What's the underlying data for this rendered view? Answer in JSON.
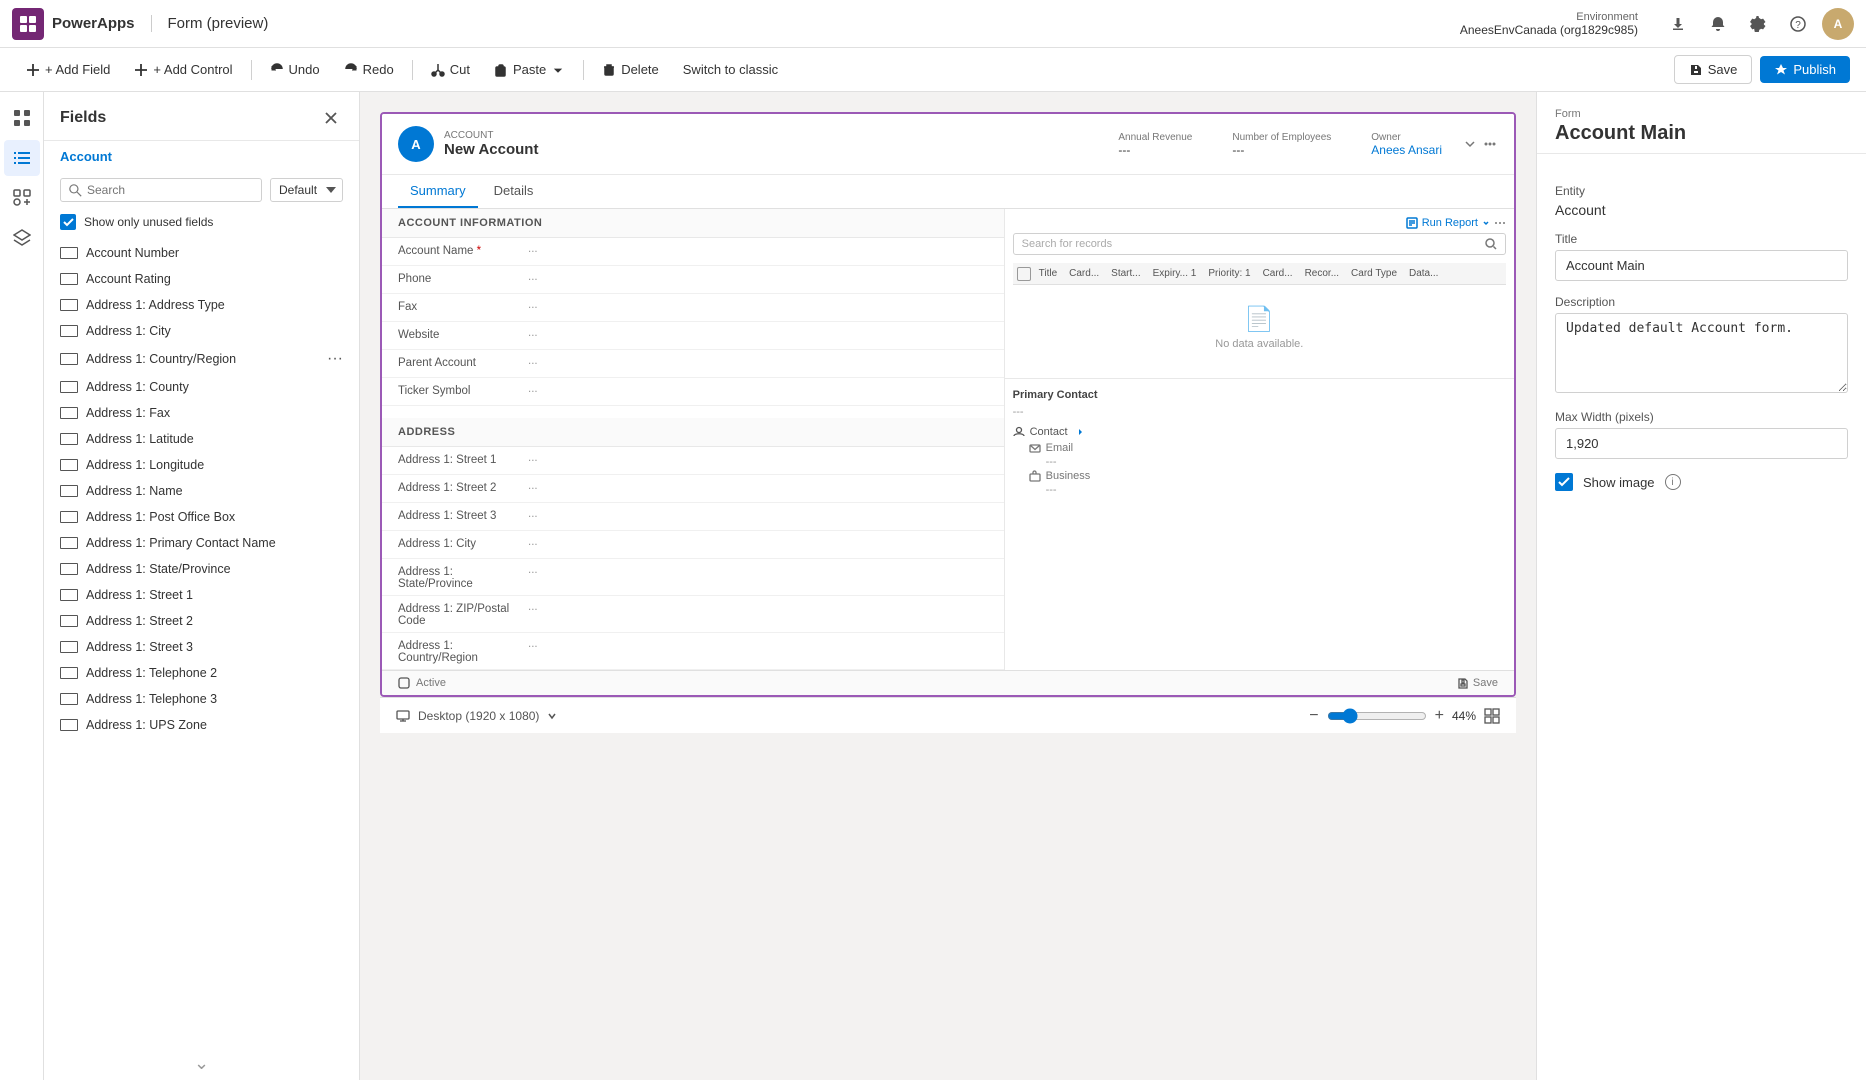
{
  "topbar": {
    "app_name": "PowerApps",
    "form_title": "Form (preview)",
    "env_label": "Environment",
    "env_name": "AneesEnvCanada (org1829c985)"
  },
  "cmdbar": {
    "add_field": "+ Add Field",
    "add_control": "+ Add Control",
    "undo": "Undo",
    "redo": "Redo",
    "cut": "Cut",
    "paste": "Paste",
    "delete": "Delete",
    "switch_classic": "Switch to classic",
    "save": "Save",
    "publish": "Publish"
  },
  "fields_panel": {
    "title": "Fields",
    "entity": "Account",
    "search_placeholder": "Search",
    "default_label": "Default",
    "show_unused_label": "Show only unused fields",
    "items": [
      {
        "name": "Account Number"
      },
      {
        "name": "Account Rating"
      },
      {
        "name": "Address 1: Address Type"
      },
      {
        "name": "Address 1: City"
      },
      {
        "name": "Address 1: Country/Region",
        "has_more": true
      },
      {
        "name": "Address 1: County"
      },
      {
        "name": "Address 1: Fax"
      },
      {
        "name": "Address 1: Latitude"
      },
      {
        "name": "Address 1: Longitude"
      },
      {
        "name": "Address 1: Name"
      },
      {
        "name": "Address 1: Post Office Box"
      },
      {
        "name": "Address 1: Primary Contact Name"
      },
      {
        "name": "Address 1: State/Province"
      },
      {
        "name": "Address 1: Street 1"
      },
      {
        "name": "Address 1: Street 2"
      },
      {
        "name": "Address 1: Street 3"
      },
      {
        "name": "Address 1: Telephone 2"
      },
      {
        "name": "Address 1: Telephone 3"
      },
      {
        "name": "Address 1: UPS Zone"
      }
    ]
  },
  "form_preview": {
    "entity_type": "ACCOUNT",
    "entity_name": "New Account",
    "header_fields": [
      {
        "label": "Annual Revenue",
        "value": "---"
      },
      {
        "label": "Number of Employees",
        "value": "---"
      },
      {
        "label": "Owner",
        "value": "Anees Ansari"
      }
    ],
    "tabs": [
      "Summary",
      "Details"
    ],
    "active_tab": "Summary",
    "section_account_info": "ACCOUNT INFORMATION",
    "fields_left": [
      {
        "label": "Account Name",
        "required": true,
        "value": "..."
      },
      {
        "label": "Phone",
        "value": "..."
      },
      {
        "label": "Fax",
        "value": "..."
      },
      {
        "label": "Website",
        "value": "..."
      },
      {
        "label": "Parent Account",
        "value": "..."
      },
      {
        "label": "Ticker Symbol",
        "value": "..."
      }
    ],
    "section_address": "ADDRESS",
    "fields_address": [
      {
        "label": "Address 1: Street 1",
        "value": "..."
      },
      {
        "label": "Address 1: Street 2",
        "value": "..."
      },
      {
        "label": "Address 1: Street 3",
        "value": "..."
      },
      {
        "label": "Address 1: City",
        "value": "..."
      },
      {
        "label": "Address 1: State/Province",
        "value": "..."
      },
      {
        "label": "Address 1: ZIP/Postal Code",
        "value": "..."
      },
      {
        "label": "Address 1: Country/Region",
        "value": "..."
      }
    ],
    "grid_columns": [
      "Title",
      "Card...",
      "Start...",
      "Expiry... 1",
      "Priority: 1",
      "Card...",
      "Recor...",
      "Card Type",
      "Data..."
    ],
    "no_data_text": "No data available.",
    "run_report": "Run Report",
    "primary_contact_label": "Primary Contact",
    "primary_contact_value": "---",
    "contact_label": "Contact",
    "contact_email_label": "Email",
    "contact_email_value": "---",
    "contact_business_label": "Business",
    "contact_business_value": "---",
    "footer_status": "Active",
    "footer_save": "Save"
  },
  "right_panel": {
    "section_label": "Form",
    "title": "Account Main",
    "entity_label": "Entity",
    "entity_value": "Account",
    "title_label": "Title",
    "title_value": "Account Main",
    "description_label": "Description",
    "description_value": "Updated default Account form.",
    "max_width_label": "Max Width (pixels)",
    "max_width_value": "1,920",
    "show_image_label": "Show image"
  },
  "bottom_bar": {
    "desktop_label": "Desktop (1920 x 1080)",
    "zoom_level": "44%"
  }
}
